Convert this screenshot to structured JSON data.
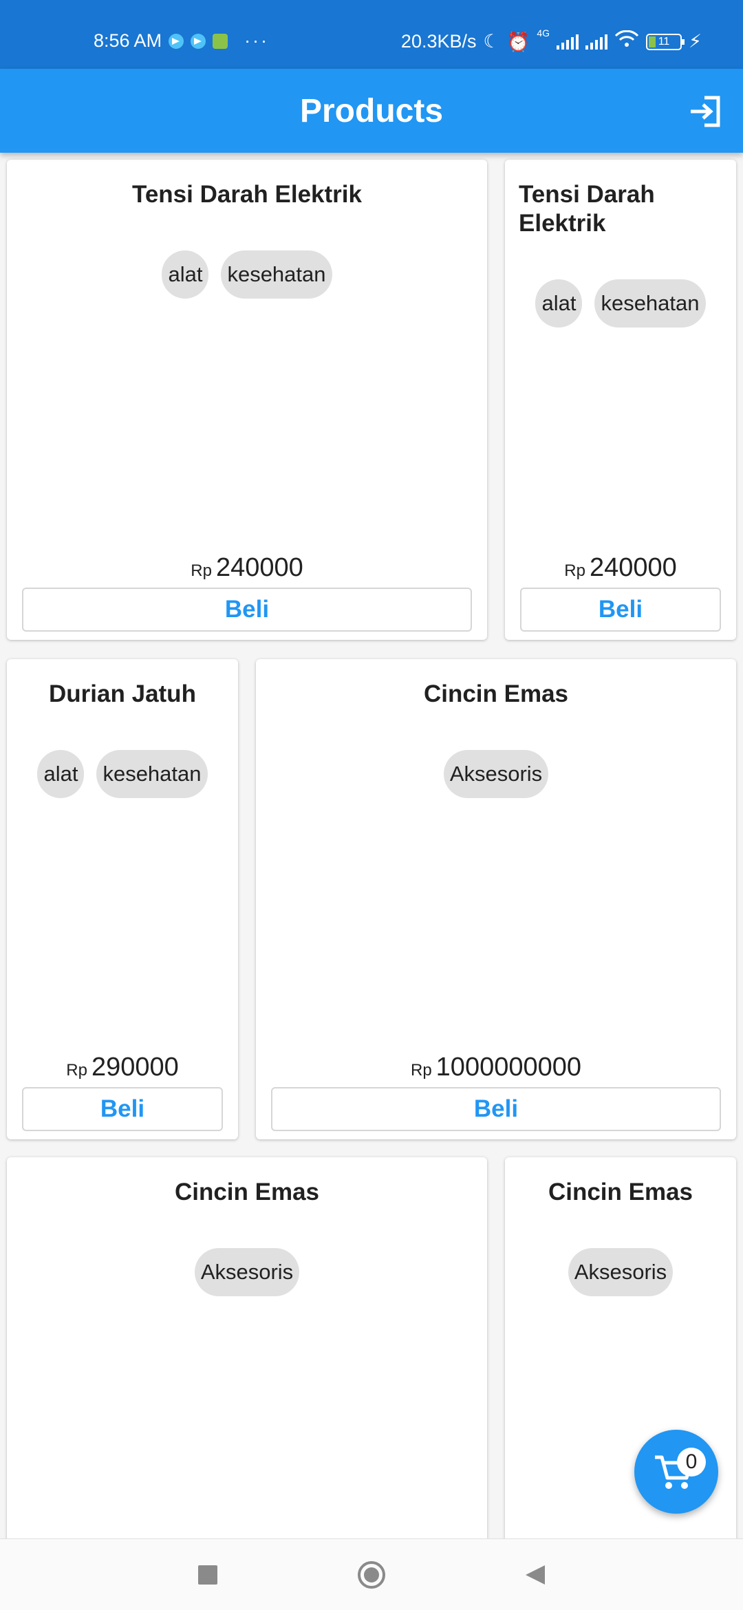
{
  "status_bar": {
    "time": "8:56 AM",
    "dots": "···",
    "net_speed": "20.3KB/s",
    "network_type": "4G",
    "battery": "11"
  },
  "app_bar": {
    "title": "Products"
  },
  "currency": "Rp",
  "buy_label": "Beli",
  "products": [
    {
      "name": "Tensi Darah Elektrik",
      "tags": [
        "alat",
        "kesehatan"
      ],
      "price": "240000"
    },
    {
      "name": "Tensi Darah Elektrik",
      "tags": [
        "alat",
        "kesehatan"
      ],
      "price": "240000"
    },
    {
      "name": "Durian Jatuh",
      "tags": [
        "alat",
        "kesehatan"
      ],
      "price": "290000"
    },
    {
      "name": "Cincin Emas",
      "tags": [
        "Aksesoris"
      ],
      "price": "1000000000"
    },
    {
      "name": "Cincin Emas",
      "tags": [
        "Aksesoris"
      ]
    },
    {
      "name": "Cincin Emas",
      "tags": [
        "Aksesoris"
      ]
    }
  ],
  "cart": {
    "count": "0"
  },
  "icons": {
    "logout": "logout-icon",
    "cart": "cart-icon",
    "nav_recent": "square-icon",
    "nav_home": "circle-icon",
    "nav_back": "triangle-back-icon"
  },
  "colors": {
    "primary": "#2196f3",
    "status_bar": "#1976d2",
    "chip": "#e0e0e0"
  }
}
